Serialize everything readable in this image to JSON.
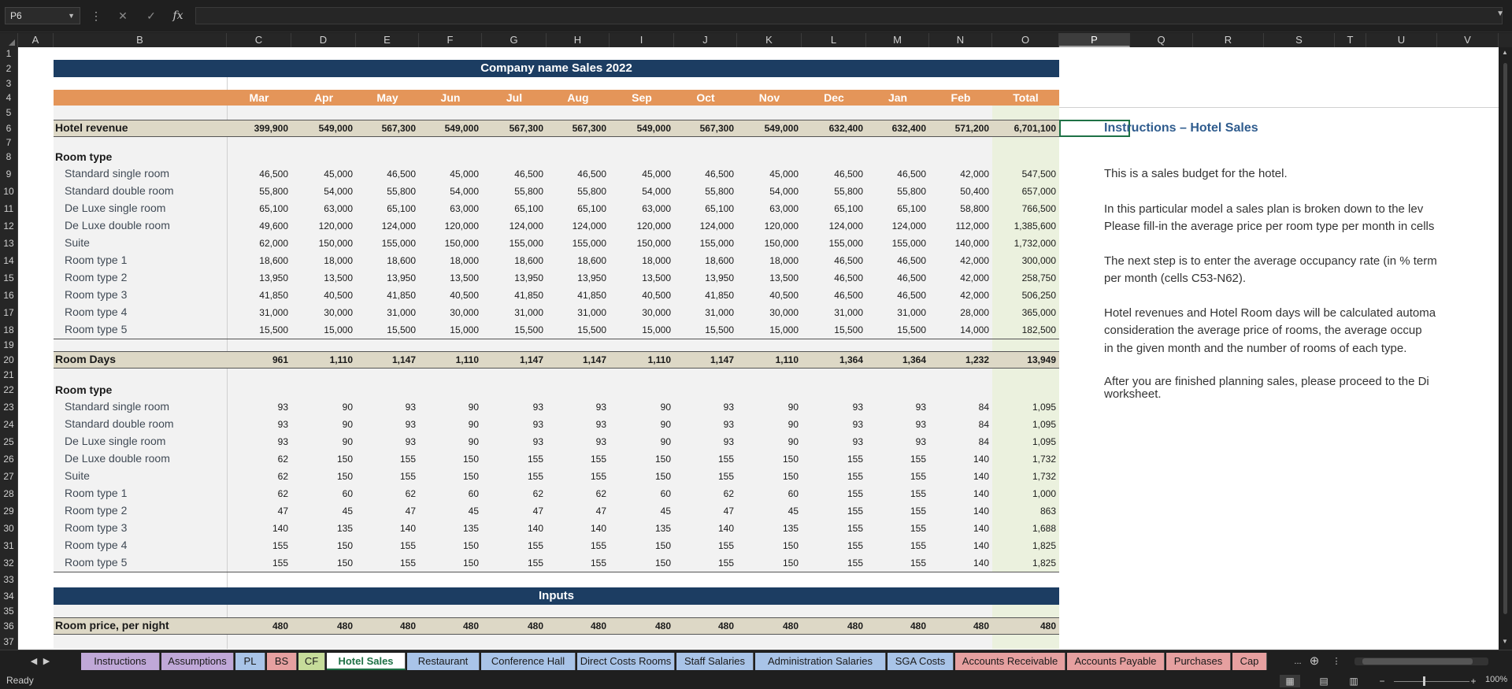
{
  "name_box": "P6",
  "icons": {
    "more": "more-vertical-icon",
    "cancel": "cancel-icon",
    "enter": "check-icon",
    "function": "fx-icon"
  },
  "columns": [
    "A",
    "B",
    "C",
    "D",
    "E",
    "F",
    "G",
    "H",
    "I",
    "J",
    "K",
    "L",
    "M",
    "N",
    "O",
    "P",
    "Q",
    "R",
    "S",
    "T",
    "U",
    "V"
  ],
  "selected_column": "P",
  "row_numbers": [
    "1",
    "2",
    "3",
    "4",
    "5",
    "6",
    "7",
    "8",
    "9",
    "10",
    "11",
    "12",
    "13",
    "14",
    "15",
    "16",
    "17",
    "18",
    "19",
    "20",
    "21",
    "22",
    "23",
    "24",
    "25",
    "26",
    "27",
    "28",
    "29",
    "30",
    "31",
    "32",
    "33",
    "34",
    "35",
    "36",
    "37"
  ],
  "sheet_title": "Company name Sales 2022",
  "months": [
    "Mar",
    "Apr",
    "May",
    "Jun",
    "Jul",
    "Aug",
    "Sep",
    "Oct",
    "Nov",
    "Dec",
    "Jan",
    "Feb",
    "Total"
  ],
  "hotel_revenue": {
    "label": "Hotel revenue",
    "values": [
      "399,900",
      "549,000",
      "567,300",
      "549,000",
      "567,300",
      "567,300",
      "549,000",
      "567,300",
      "549,000",
      "632,400",
      "632,400",
      "571,200",
      "6,701,100"
    ]
  },
  "revenue_section_label": "Room type",
  "revenue_rows": [
    {
      "label": "Standard single room",
      "values": [
        "46,500",
        "45,000",
        "46,500",
        "45,000",
        "46,500",
        "46,500",
        "45,000",
        "46,500",
        "45,000",
        "46,500",
        "46,500",
        "42,000",
        "547,500"
      ]
    },
    {
      "label": "Standard double room",
      "values": [
        "55,800",
        "54,000",
        "55,800",
        "54,000",
        "55,800",
        "55,800",
        "54,000",
        "55,800",
        "54,000",
        "55,800",
        "55,800",
        "50,400",
        "657,000"
      ]
    },
    {
      "label": "De Luxe single room",
      "values": [
        "65,100",
        "63,000",
        "65,100",
        "63,000",
        "65,100",
        "65,100",
        "63,000",
        "65,100",
        "63,000",
        "65,100",
        "65,100",
        "58,800",
        "766,500"
      ]
    },
    {
      "label": "De Luxe double room",
      "values": [
        "49,600",
        "120,000",
        "124,000",
        "120,000",
        "124,000",
        "124,000",
        "120,000",
        "124,000",
        "120,000",
        "124,000",
        "124,000",
        "112,000",
        "1,385,600"
      ]
    },
    {
      "label": "Suite",
      "values": [
        "62,000",
        "150,000",
        "155,000",
        "150,000",
        "155,000",
        "155,000",
        "150,000",
        "155,000",
        "150,000",
        "155,000",
        "155,000",
        "140,000",
        "1,732,000"
      ]
    },
    {
      "label": "Room type 1",
      "values": [
        "18,600",
        "18,000",
        "18,600",
        "18,000",
        "18,600",
        "18,600",
        "18,000",
        "18,600",
        "18,000",
        "46,500",
        "46,500",
        "42,000",
        "300,000"
      ]
    },
    {
      "label": "Room type 2",
      "values": [
        "13,950",
        "13,500",
        "13,950",
        "13,500",
        "13,950",
        "13,950",
        "13,500",
        "13,950",
        "13,500",
        "46,500",
        "46,500",
        "42,000",
        "258,750"
      ]
    },
    {
      "label": "Room type 3",
      "values": [
        "41,850",
        "40,500",
        "41,850",
        "40,500",
        "41,850",
        "41,850",
        "40,500",
        "41,850",
        "40,500",
        "46,500",
        "46,500",
        "42,000",
        "506,250"
      ]
    },
    {
      "label": "Room type 4",
      "values": [
        "31,000",
        "30,000",
        "31,000",
        "30,000",
        "31,000",
        "31,000",
        "30,000",
        "31,000",
        "30,000",
        "31,000",
        "31,000",
        "28,000",
        "365,000"
      ]
    },
    {
      "label": "Room type 5",
      "values": [
        "15,500",
        "15,000",
        "15,500",
        "15,000",
        "15,500",
        "15,500",
        "15,000",
        "15,500",
        "15,000",
        "15,500",
        "15,500",
        "14,000",
        "182,500"
      ]
    }
  ],
  "room_days": {
    "label": "Room Days",
    "values": [
      "961",
      "1,110",
      "1,147",
      "1,110",
      "1,147",
      "1,147",
      "1,110",
      "1,147",
      "1,110",
      "1,364",
      "1,364",
      "1,232",
      "13,949"
    ]
  },
  "days_section_label": "Room type",
  "days_rows": [
    {
      "label": "Standard single room",
      "values": [
        "93",
        "90",
        "93",
        "90",
        "93",
        "93",
        "90",
        "93",
        "90",
        "93",
        "93",
        "84",
        "1,095"
      ]
    },
    {
      "label": "Standard double room",
      "values": [
        "93",
        "90",
        "93",
        "90",
        "93",
        "93",
        "90",
        "93",
        "90",
        "93",
        "93",
        "84",
        "1,095"
      ]
    },
    {
      "label": "De Luxe single room",
      "values": [
        "93",
        "90",
        "93",
        "90",
        "93",
        "93",
        "90",
        "93",
        "90",
        "93",
        "93",
        "84",
        "1,095"
      ]
    },
    {
      "label": "De Luxe double room",
      "values": [
        "62",
        "150",
        "155",
        "150",
        "155",
        "155",
        "150",
        "155",
        "150",
        "155",
        "155",
        "140",
        "1,732"
      ]
    },
    {
      "label": "Suite",
      "values": [
        "62",
        "150",
        "155",
        "150",
        "155",
        "155",
        "150",
        "155",
        "150",
        "155",
        "155",
        "140",
        "1,732"
      ]
    },
    {
      "label": "Room type 1",
      "values": [
        "62",
        "60",
        "62",
        "60",
        "62",
        "62",
        "60",
        "62",
        "60",
        "155",
        "155",
        "140",
        "1,000"
      ]
    },
    {
      "label": "Room type 2",
      "values": [
        "47",
        "45",
        "47",
        "45",
        "47",
        "47",
        "45",
        "47",
        "45",
        "155",
        "155",
        "140",
        "863"
      ]
    },
    {
      "label": "Room type 3",
      "values": [
        "140",
        "135",
        "140",
        "135",
        "140",
        "140",
        "135",
        "140",
        "135",
        "155",
        "155",
        "140",
        "1,688"
      ]
    },
    {
      "label": "Room type 4",
      "values": [
        "155",
        "150",
        "155",
        "150",
        "155",
        "155",
        "150",
        "155",
        "150",
        "155",
        "155",
        "140",
        "1,825"
      ]
    },
    {
      "label": "Room type 5",
      "values": [
        "155",
        "150",
        "155",
        "150",
        "155",
        "155",
        "150",
        "155",
        "150",
        "155",
        "155",
        "140",
        "1,825"
      ]
    }
  ],
  "inputs_title": "Inputs",
  "room_price": {
    "label": "Room price, per night",
    "values": [
      "480",
      "480",
      "480",
      "480",
      "480",
      "480",
      "480",
      "480",
      "480",
      "480",
      "480",
      "480",
      "480"
    ]
  },
  "instructions": {
    "title": "Instructions – Hotel Sales",
    "lines": [
      "This is a sales budget for the hotel.",
      "In this particular model a sales plan is broken down to the lev",
      "Please fill-in the average price per room type per month in cells",
      "The next step is to enter the average occupancy rate (in % term",
      "per month (cells C53-N62).",
      "Hotel revenues and Hotel Room days will be calculated automa",
      "consideration the average price of rooms, the average occup",
      "in the given month and the number of rooms of each type.",
      "After you are finished planning sales, please proceed to the Di",
      "worksheet."
    ]
  },
  "tabs": [
    {
      "label": "Instructions",
      "color": "#c0a8d8"
    },
    {
      "label": "Assumptions",
      "color": "#c0a8d8"
    },
    {
      "label": "PL",
      "color": "#a9c4e8"
    },
    {
      "label": "BS",
      "color": "#e6a0a0"
    },
    {
      "label": "CF",
      "color": "#c6dc9a"
    },
    {
      "label": "Hotel Sales",
      "color": "#ffffff"
    },
    {
      "label": "Restaurant",
      "color": "#a9c4e8"
    },
    {
      "label": "Conference Hall",
      "color": "#a9c4e8"
    },
    {
      "label": "Direct Costs Rooms",
      "color": "#a9c4e8"
    },
    {
      "label": "Staff Salaries",
      "color": "#a9c4e8"
    },
    {
      "label": "Administration Salaries",
      "color": "#a9c4e8"
    },
    {
      "label": "SGA Costs",
      "color": "#a9c4e8"
    },
    {
      "label": "Accounts Receivable",
      "color": "#e6a0a0"
    },
    {
      "label": "Accounts Payable",
      "color": "#e6a0a0"
    },
    {
      "label": "Purchases",
      "color": "#e6a0a0"
    },
    {
      "label": "Cap",
      "color": "#e6a0a0"
    }
  ],
  "active_tab": "Hotel Sales",
  "tab_more": "...",
  "status_text": "Ready",
  "zoom": "100%"
}
